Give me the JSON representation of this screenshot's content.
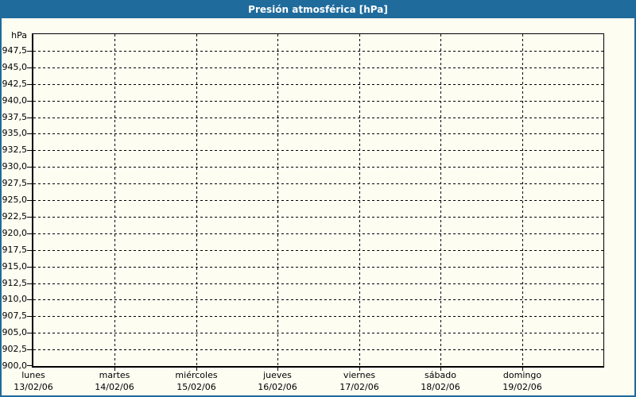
{
  "window": {
    "title": "Presión atmosférica [hPa]"
  },
  "colors": {
    "header_bg": "#1f6b9c",
    "header_text": "#ffffff",
    "page_bg": "#fdfdf2",
    "grid": "#000000",
    "text": "#000000"
  },
  "chart_data": {
    "type": "line",
    "title": "Presión atmosférica [hPa]",
    "grid": "dashed",
    "legend": "none",
    "series": [],
    "y_axis": {
      "unit_label": "hPa",
      "min": 900,
      "max": 950,
      "tick_step": 2.5,
      "tick_values": [
        947.5,
        945.0,
        942.5,
        940.0,
        937.5,
        935.0,
        932.5,
        930.0,
        927.5,
        925.0,
        922.5,
        920.0,
        917.5,
        915.0,
        912.5,
        910.0,
        907.5,
        905.0,
        902.5,
        900.0
      ],
      "tick_labels": [
        "947,5",
        "945,0",
        "942,5",
        "940,0",
        "937,5",
        "935,0",
        "932,5",
        "930,0",
        "927,5",
        "925,0",
        "922,5",
        "920,0",
        "917,5",
        "915,0",
        "912,5",
        "910,0",
        "907,5",
        "905,0",
        "902,5",
        "900,0"
      ]
    },
    "x_axis": {
      "categories": [
        {
          "day": "lunes",
          "date": "13/02/06"
        },
        {
          "day": "martes",
          "date": "14/02/06"
        },
        {
          "day": "miércoles",
          "date": "15/02/06"
        },
        {
          "day": "jueves",
          "date": "16/02/06"
        },
        {
          "day": "viernes",
          "date": "17/02/06"
        },
        {
          "day": "sábado",
          "date": "18/02/06"
        },
        {
          "day": "domingo",
          "date": "19/02/06"
        }
      ]
    }
  }
}
